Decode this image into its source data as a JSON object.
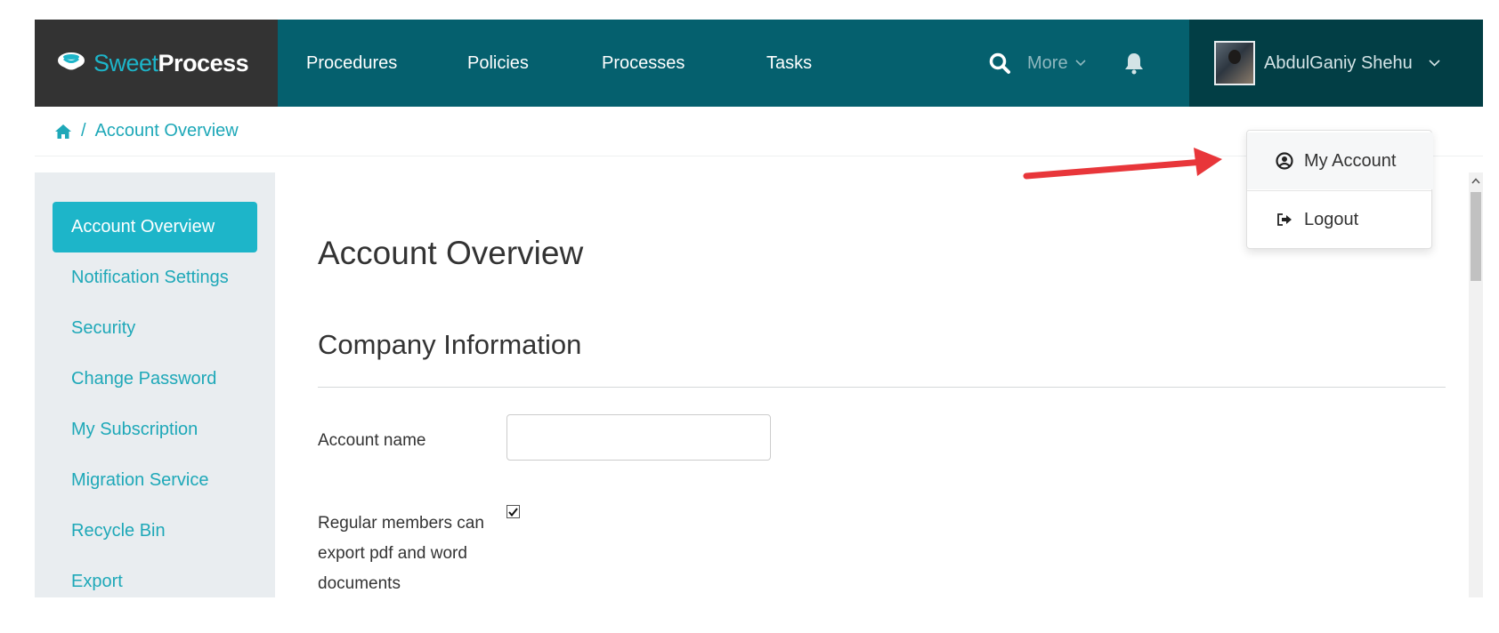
{
  "brand": {
    "light": "Sweet",
    "bold": "Process"
  },
  "nav": {
    "items": [
      {
        "label": "Procedures"
      },
      {
        "label": "Policies"
      },
      {
        "label": "Processes"
      },
      {
        "label": "Tasks"
      }
    ],
    "more_label": "More",
    "user_name": "AbdulGaniy Shehu"
  },
  "breadcrumb": {
    "separator": "/",
    "current": "Account Overview"
  },
  "sidebar": {
    "items": [
      {
        "label": "Account Overview",
        "active": true
      },
      {
        "label": "Notification Settings"
      },
      {
        "label": "Security"
      },
      {
        "label": "Change Password"
      },
      {
        "label": "My Subscription"
      },
      {
        "label": "Migration Service"
      },
      {
        "label": "Recycle Bin"
      },
      {
        "label": "Export"
      }
    ]
  },
  "main": {
    "title": "Account Overview",
    "section_title": "Company Information",
    "account_name_label": "Account name",
    "account_name_value": "",
    "export_label": "Regular members can export pdf and word documents",
    "export_checked": true
  },
  "user_menu": {
    "items": [
      {
        "label": "My Account",
        "icon": "user-circle-icon"
      },
      {
        "label": "Logout",
        "icon": "logout-icon"
      }
    ]
  },
  "colors": {
    "nav_bg": "#05606e",
    "brand_bg": "#333333",
    "user_bg": "#023e45",
    "accent": "#1db5c9",
    "link": "#1ea8b8",
    "sidebar_bg": "#e9edf0",
    "annotation_arrow": "#e8363a"
  }
}
